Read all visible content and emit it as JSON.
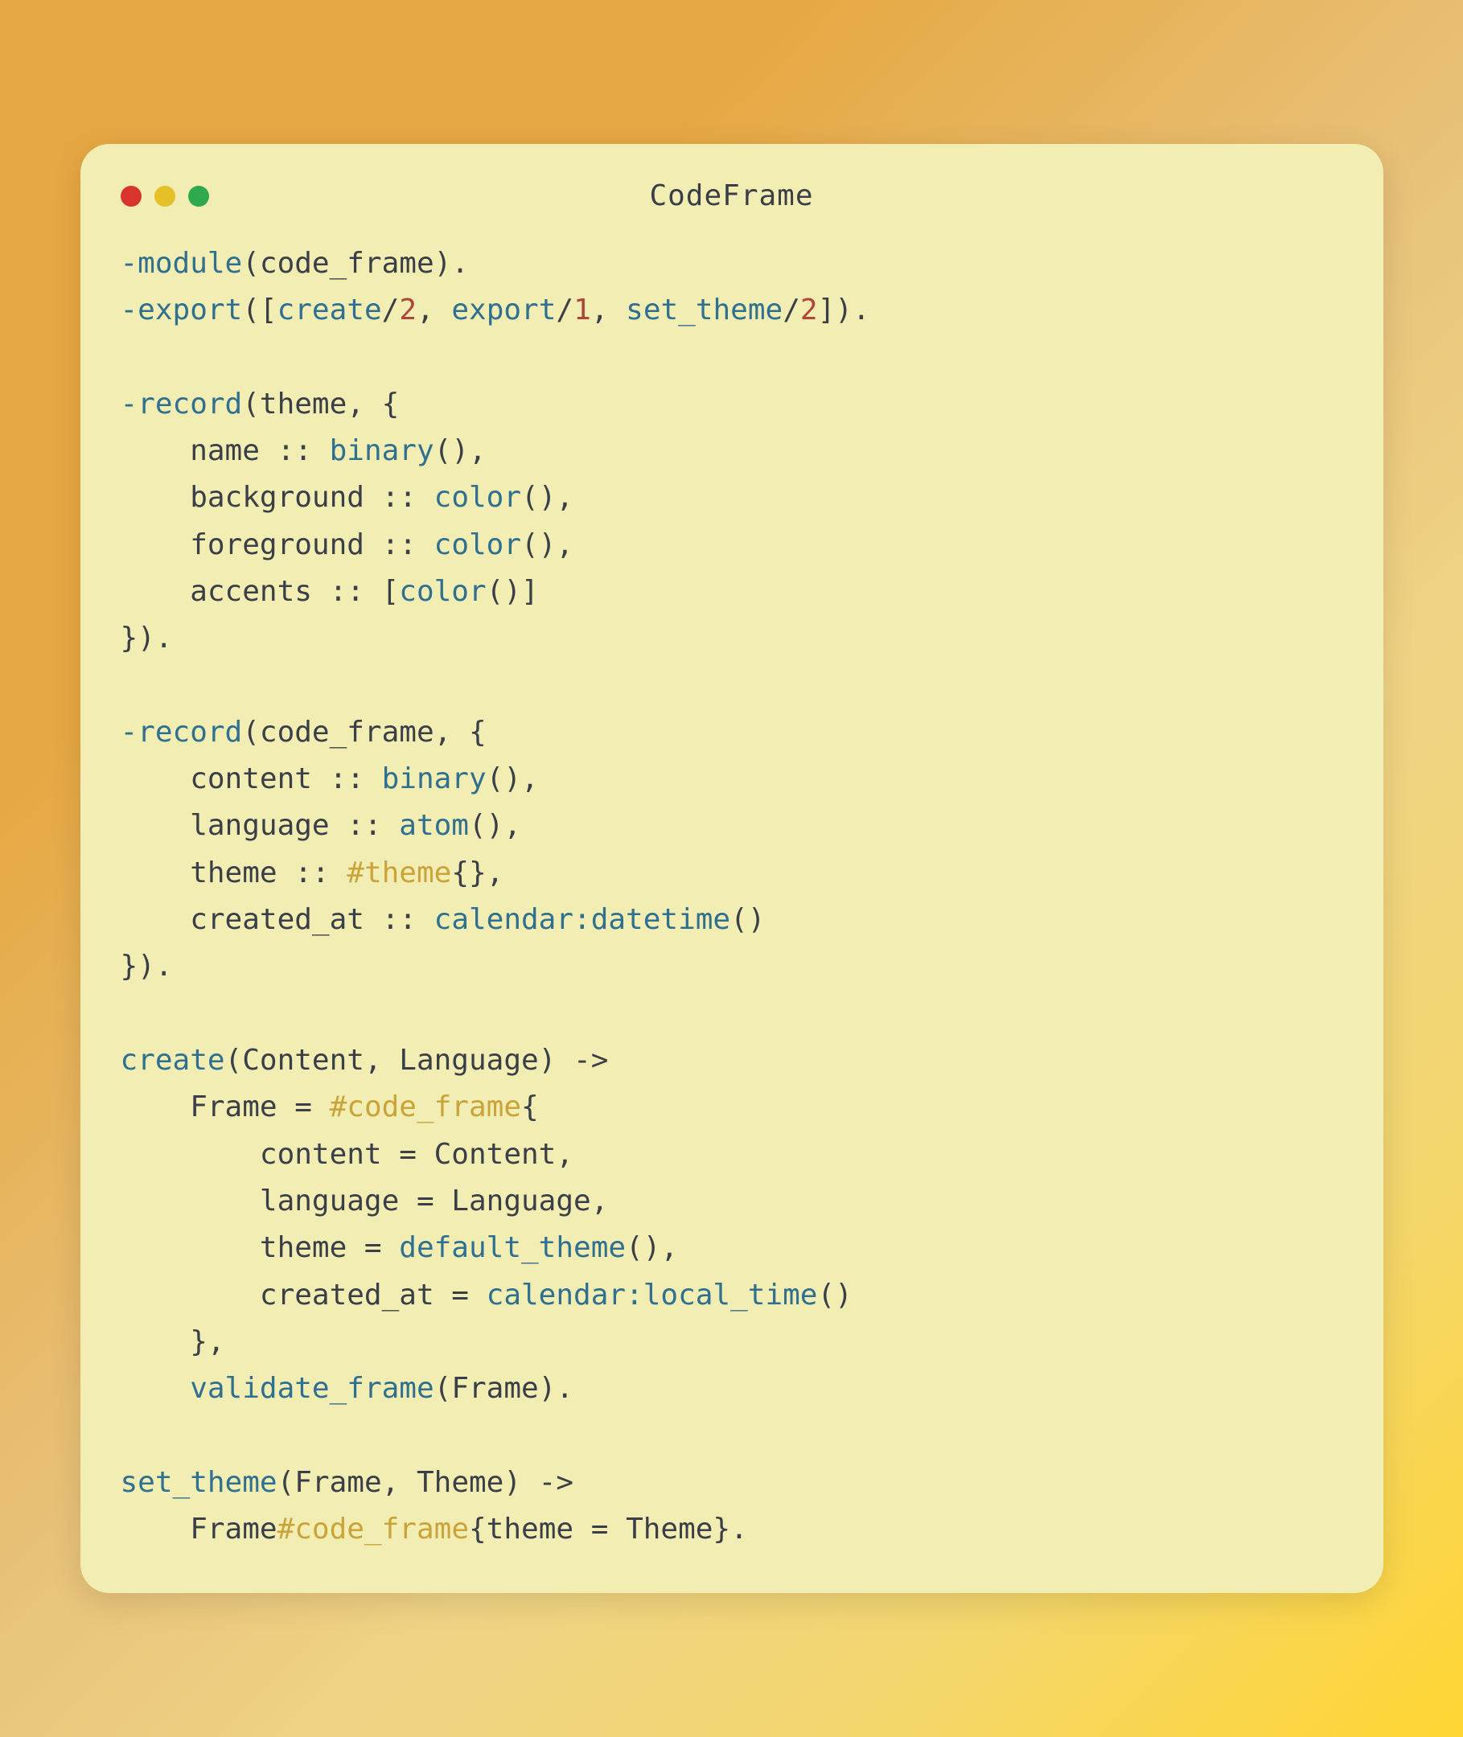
{
  "window": {
    "title": "CodeFrame",
    "traffic_lights": {
      "close": "red",
      "minimize": "yellow",
      "zoom": "green"
    }
  },
  "code": {
    "language": "erlang",
    "tokens": [
      [
        {
          "t": "-module",
          "c": "kw"
        },
        {
          "t": "(code_frame).",
          "c": "plain"
        }
      ],
      [
        {
          "t": "-export",
          "c": "kw"
        },
        {
          "t": "([",
          "c": "plain"
        },
        {
          "t": "create",
          "c": "fn"
        },
        {
          "t": "/",
          "c": "plain"
        },
        {
          "t": "2",
          "c": "num"
        },
        {
          "t": ", ",
          "c": "plain"
        },
        {
          "t": "export",
          "c": "fn"
        },
        {
          "t": "/",
          "c": "plain"
        },
        {
          "t": "1",
          "c": "num"
        },
        {
          "t": ", ",
          "c": "plain"
        },
        {
          "t": "set_theme",
          "c": "fn"
        },
        {
          "t": "/",
          "c": "plain"
        },
        {
          "t": "2",
          "c": "num"
        },
        {
          "t": "]).",
          "c": "plain"
        }
      ],
      [],
      [
        {
          "t": "-record",
          "c": "kw"
        },
        {
          "t": "(theme, {",
          "c": "plain"
        }
      ],
      [
        {
          "t": "    name :: ",
          "c": "plain"
        },
        {
          "t": "binary",
          "c": "typ"
        },
        {
          "t": "(),",
          "c": "plain"
        }
      ],
      [
        {
          "t": "    background :: ",
          "c": "plain"
        },
        {
          "t": "color",
          "c": "typ"
        },
        {
          "t": "(),",
          "c": "plain"
        }
      ],
      [
        {
          "t": "    foreground :: ",
          "c": "plain"
        },
        {
          "t": "color",
          "c": "typ"
        },
        {
          "t": "(),",
          "c": "plain"
        }
      ],
      [
        {
          "t": "    accents :: [",
          "c": "plain"
        },
        {
          "t": "color",
          "c": "typ"
        },
        {
          "t": "()]",
          "c": "plain"
        }
      ],
      [
        {
          "t": "}).",
          "c": "plain"
        }
      ],
      [],
      [
        {
          "t": "-record",
          "c": "kw"
        },
        {
          "t": "(code_frame, {",
          "c": "plain"
        }
      ],
      [
        {
          "t": "    content :: ",
          "c": "plain"
        },
        {
          "t": "binary",
          "c": "typ"
        },
        {
          "t": "(),",
          "c": "plain"
        }
      ],
      [
        {
          "t": "    language :: ",
          "c": "plain"
        },
        {
          "t": "atom",
          "c": "typ"
        },
        {
          "t": "(),",
          "c": "plain"
        }
      ],
      [
        {
          "t": "    theme :: ",
          "c": "plain"
        },
        {
          "t": "#theme",
          "c": "rec"
        },
        {
          "t": "{},",
          "c": "plain"
        }
      ],
      [
        {
          "t": "    created_at :: ",
          "c": "plain"
        },
        {
          "t": "calendar:datetime",
          "c": "typ"
        },
        {
          "t": "()",
          "c": "plain"
        }
      ],
      [
        {
          "t": "}).",
          "c": "plain"
        }
      ],
      [],
      [
        {
          "t": "create",
          "c": "fn"
        },
        {
          "t": "(Content, Language) ->",
          "c": "plain"
        }
      ],
      [
        {
          "t": "    Frame = ",
          "c": "plain"
        },
        {
          "t": "#code_frame",
          "c": "rec"
        },
        {
          "t": "{",
          "c": "plain"
        }
      ],
      [
        {
          "t": "        content = Content,",
          "c": "plain"
        }
      ],
      [
        {
          "t": "        language = Language,",
          "c": "plain"
        }
      ],
      [
        {
          "t": "        theme = ",
          "c": "plain"
        },
        {
          "t": "default_theme",
          "c": "fn"
        },
        {
          "t": "(),",
          "c": "plain"
        }
      ],
      [
        {
          "t": "        created_at = ",
          "c": "plain"
        },
        {
          "t": "calendar:local_time",
          "c": "fn"
        },
        {
          "t": "()",
          "c": "plain"
        }
      ],
      [
        {
          "t": "    },",
          "c": "plain"
        }
      ],
      [
        {
          "t": "    ",
          "c": "plain"
        },
        {
          "t": "validate_frame",
          "c": "fn"
        },
        {
          "t": "(Frame).",
          "c": "plain"
        }
      ],
      [],
      [
        {
          "t": "set_theme",
          "c": "fn"
        },
        {
          "t": "(Frame, Theme) ->",
          "c": "plain"
        }
      ],
      [
        {
          "t": "    Frame",
          "c": "plain"
        },
        {
          "t": "#code_frame",
          "c": "rec"
        },
        {
          "t": "{theme = Theme}.",
          "c": "plain"
        }
      ]
    ]
  }
}
